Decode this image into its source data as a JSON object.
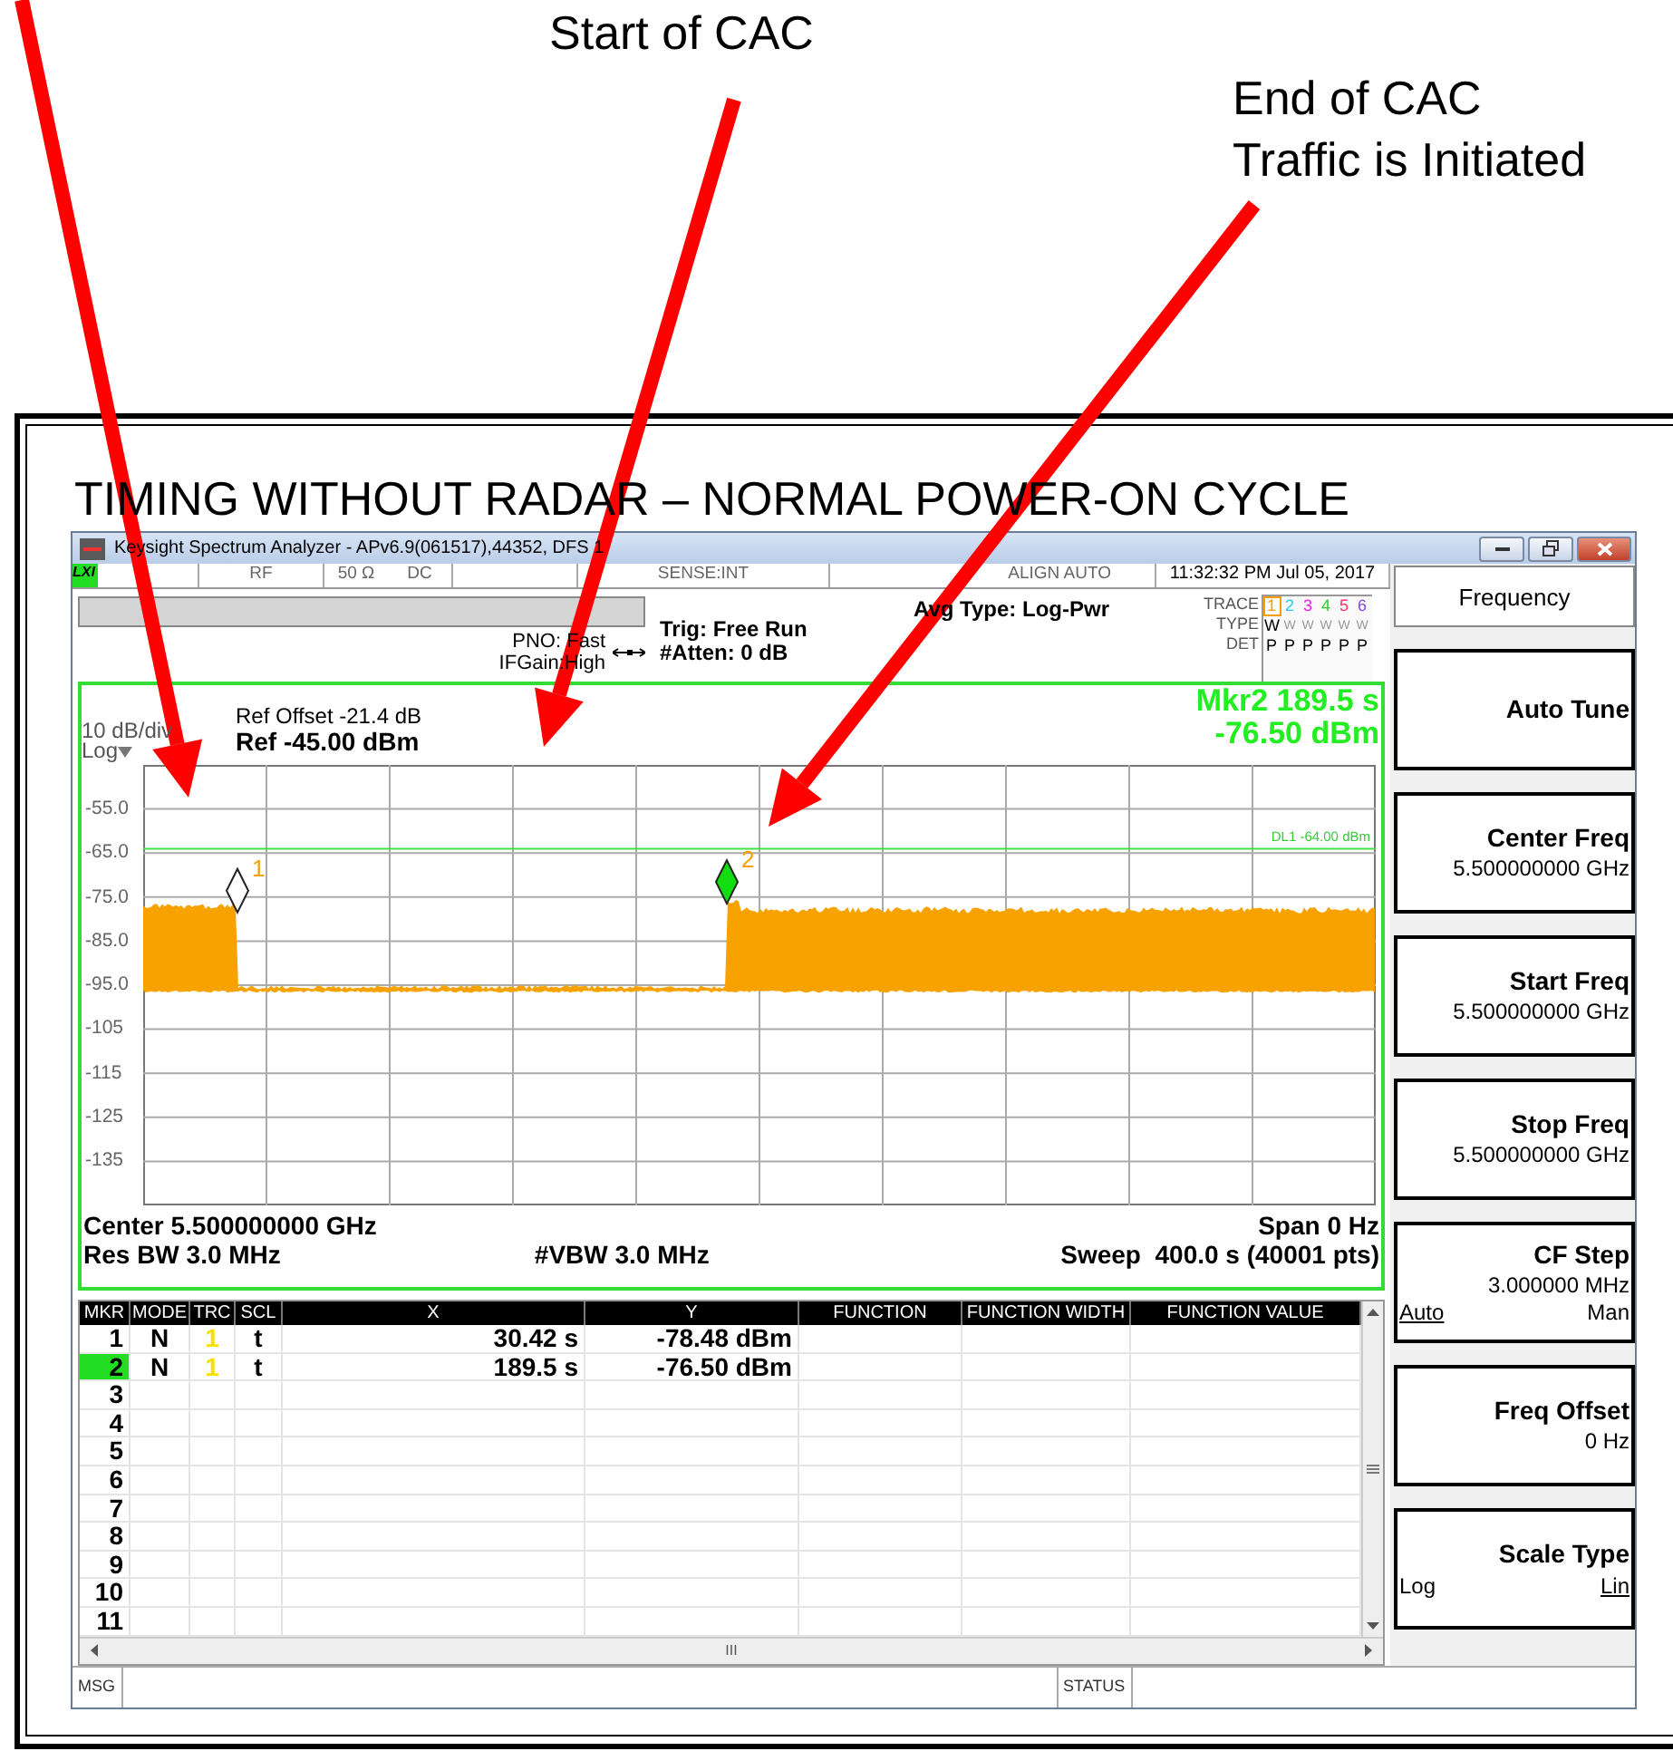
{
  "annotations": [
    {
      "lines": [
        "Start of CAC"
      ]
    },
    {
      "lines": [
        "End of CAC",
        "Traffic is Initiated"
      ]
    }
  ],
  "figure_title": "TIMING WITHOUT RADAR – NORMAL POWER-ON CYCLE",
  "window": {
    "title": "Keysight Spectrum Analyzer - APv6.9(061517),44352, DFS 1"
  },
  "status_row": {
    "lxi": "LXI",
    "cells": [
      "RF",
      "50 Ω",
      "DC",
      "SENSE:INT",
      "ALIGN AUTO"
    ],
    "datetime": "11:32:32 PM Jul 05, 2017"
  },
  "settings": {
    "pno": "PNO: Fast",
    "ifgain": "IFGain:High",
    "trig": "Trig: Free Run",
    "atten": "#Atten: 0 dB",
    "avg_type": "Avg Type: Log-Pwr"
  },
  "trace_table": {
    "row_labels": [
      "TRACE",
      "TYPE",
      "DET"
    ],
    "traces": [
      {
        "number": "1",
        "color": "#f5a000",
        "selected": true,
        "type": "W",
        "det": "P"
      },
      {
        "number": "2",
        "color": "#22ccee",
        "selected": false,
        "type": "W",
        "det": "P"
      },
      {
        "number": "3",
        "color": "#ee22ee",
        "selected": false,
        "type": "W",
        "det": "P"
      },
      {
        "number": "4",
        "color": "#33cc33",
        "selected": false,
        "type": "W",
        "det": "P"
      },
      {
        "number": "5",
        "color": "#ff3366",
        "selected": false,
        "type": "W",
        "det": "P"
      },
      {
        "number": "6",
        "color": "#8844ee",
        "selected": false,
        "type": "W",
        "det": "P"
      }
    ]
  },
  "graph": {
    "ref_offset": "Ref Offset -21.4 dB",
    "ref_level": "Ref -45.00 dBm",
    "scale": "10 dB/div",
    "scale_type": "Log",
    "marker_readout": [
      "Mkr2 189.5 s",
      "-76.50 dBm"
    ],
    "y_labels": [
      "-55.0",
      "-65.0",
      "-75.0",
      "-85.0",
      "-95.0",
      "-105",
      "-115",
      "-125",
      "-135"
    ],
    "display_line": "DL1 -64.00 dBm",
    "markers": [
      {
        "label": "1",
        "selected": false
      },
      {
        "label": "2",
        "selected": true
      }
    ],
    "center": "Center 5.500000000 GHz",
    "span": "Span 0 Hz",
    "res_bw": "Res BW 3.0 MHz",
    "vbw": "#VBW 3.0 MHz",
    "sweep": "Sweep  400.0 s (40001 pts)"
  },
  "marker_table": {
    "columns": [
      "MKR",
      "MODE",
      "TRC",
      "SCL",
      "X",
      "Y",
      "FUNCTION",
      "FUNCTION WIDTH",
      "FUNCTION VALUE"
    ],
    "rows": [
      {
        "cells": [
          "1",
          "N",
          "1",
          "t",
          "30.42 s",
          "-78.48 dBm"
        ],
        "selected": false
      },
      {
        "cells": [
          "2",
          "N",
          "1",
          "t",
          "189.5 s",
          "-76.50 dBm"
        ],
        "selected": true
      },
      {
        "cells": [
          "3"
        ],
        "selected": false
      },
      {
        "cells": [
          "4"
        ],
        "selected": false
      },
      {
        "cells": [
          "5"
        ],
        "selected": false
      },
      {
        "cells": [
          "6"
        ],
        "selected": false
      },
      {
        "cells": [
          "7"
        ],
        "selected": false
      },
      {
        "cells": [
          "8"
        ],
        "selected": false
      },
      {
        "cells": [
          "9"
        ],
        "selected": false
      },
      {
        "cells": [
          "10"
        ],
        "selected": false
      },
      {
        "cells": [
          "11"
        ],
        "selected": false
      }
    ],
    "scroll_grip": "III"
  },
  "softkeys": {
    "title": "Frequency",
    "keys": [
      {
        "kind": "plain",
        "label": "Auto Tune"
      },
      {
        "kind": "value",
        "label": "Center Freq",
        "value": "5.500000000 GHz"
      },
      {
        "kind": "value",
        "label": "Start Freq",
        "value": "5.500000000 GHz"
      },
      {
        "kind": "value",
        "label": "Stop Freq",
        "value": "5.500000000 GHz"
      },
      {
        "kind": "toggle",
        "label": "CF Step",
        "value": "3.000000 MHz",
        "options": [
          {
            "text": "Auto",
            "underlined": true
          },
          {
            "text": "Man",
            "underlined": false
          }
        ]
      },
      {
        "kind": "value",
        "label": "Freq Offset",
        "value": "0 Hz"
      },
      {
        "kind": "toggle",
        "label": "Scale Type",
        "options": [
          {
            "text": "Log",
            "underlined": false
          },
          {
            "text": "Lin",
            "underlined": true
          }
        ]
      }
    ]
  },
  "status_bar": {
    "msg": "MSG",
    "status": "STATUS"
  }
}
